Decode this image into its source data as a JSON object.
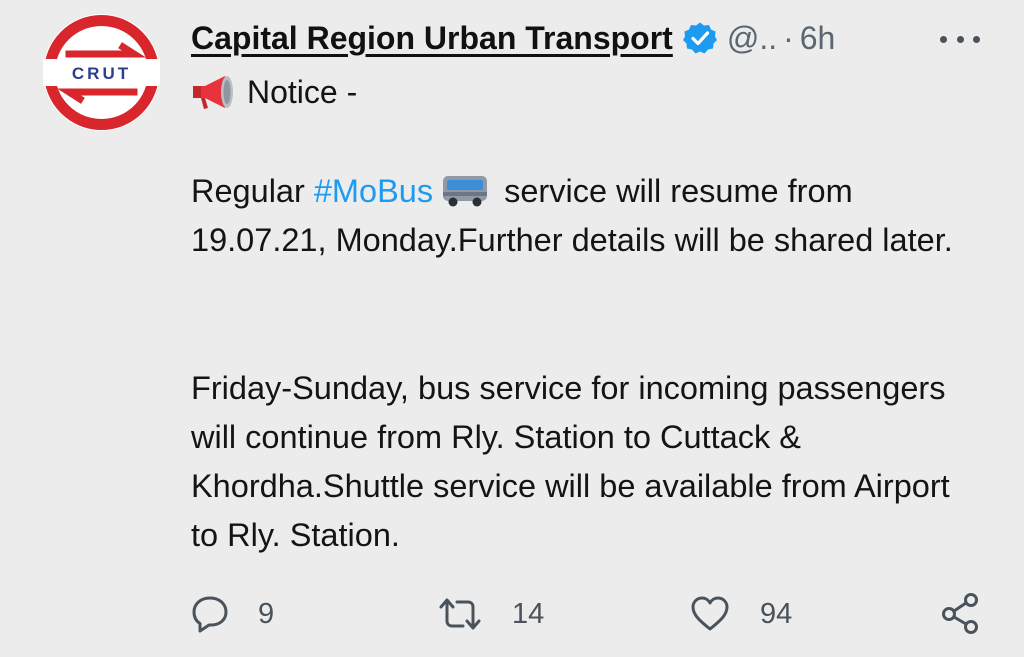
{
  "tweet": {
    "author": {
      "name": "Capital Region Urban Transport",
      "handle": "@..",
      "separator": "·",
      "time": "6h",
      "verified": true,
      "avatar_text": "CRUT"
    },
    "notice_label": "Notice -",
    "paragraph1": {
      "before": "Regular ",
      "hashtag": "#MoBus",
      "after": " service will resume from 19.07.21, Monday.Further details will be shared later."
    },
    "paragraph2": "Friday-Sunday, bus service for incoming passengers will continue from Rly. Station to Cuttack & Khordha.Shuttle service will be available from Airport to Rly. Station.",
    "actions": {
      "reply_count": "9",
      "retweet_count": "14",
      "like_count": "94"
    }
  },
  "colors": {
    "background": "#ececec",
    "hashtag": "#1d9bf0",
    "verified": "#1d9bf0",
    "logo_red": "#d9262c",
    "muted": "#5b6670"
  },
  "icons": [
    "megaphone-icon",
    "bus-icon",
    "verified-badge-icon",
    "more-icon",
    "reply-icon",
    "retweet-icon",
    "like-icon",
    "share-icon"
  ]
}
